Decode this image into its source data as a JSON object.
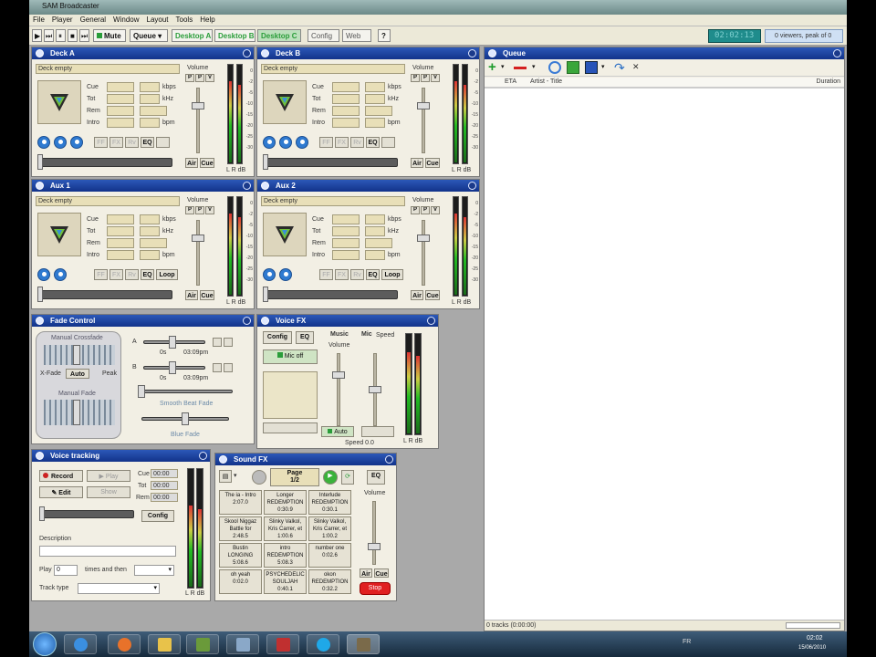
{
  "app": {
    "title": "SAM Broadcaster"
  },
  "menu": [
    "File",
    "Player",
    "General",
    "Window",
    "Layout",
    "Tools",
    "Help"
  ],
  "toolbar": {
    "mute": "Mute",
    "queue": "Queue",
    "desktops": [
      "Desktop A",
      "Desktop B",
      "Desktop C"
    ],
    "config": "Config",
    "web": "Web",
    "help": "?",
    "clock": "02:02:13",
    "listeners": "0 viewers, peak of 0"
  },
  "decks": [
    {
      "title": "Deck A",
      "status": "Deck empty",
      "loop": ""
    },
    {
      "title": "Deck B",
      "status": "Deck empty",
      "loop": ""
    },
    {
      "title": "Aux 1",
      "status": "Deck empty",
      "loop": "Loop"
    },
    {
      "title": "Aux 2",
      "status": "Deck empty",
      "loop": "Loop"
    }
  ],
  "deck_labels": {
    "cue": "Cue",
    "tot": "Tot",
    "rem": "Rem",
    "intro": "Intro",
    "kbps": "kbps",
    "khz": "kHz",
    "bpm": "bpm",
    "volume": "Volume",
    "eq": "EQ",
    "air": "Air",
    "cue_btn": "Cue",
    "lr_db": "L R dB",
    "pfl": [
      "P",
      "P",
      "V"
    ],
    "scale": [
      "0",
      "-2",
      "-5",
      "-10",
      "-15",
      "-20",
      "-25",
      "-30"
    ]
  },
  "fade": {
    "title": "Fade Control",
    "manual_crossfade": "Manual Crossfade",
    "xfade": "X-Fade",
    "auto": "Auto",
    "peak": "Peak",
    "manual_fade": "Manual Fade",
    "a": "A",
    "b": "B",
    "a_val": "0s",
    "a_time": "03:09pm",
    "b_val": "0s",
    "b_time": "03:09pm",
    "smooth": "Smooth Beat Fade",
    "blue_fade": "Blue Fade"
  },
  "voicefx": {
    "title": "Voice FX",
    "config": "Config",
    "eq": "EQ",
    "mic_off": "Mic off",
    "music": "Music",
    "volume": "Volume",
    "mic": "Mic",
    "speed": "Speed",
    "auto": "Auto",
    "speed_val": "Speed 0.0",
    "lr_db": "L R dB"
  },
  "voicetracking": {
    "title": "Voice tracking",
    "record": "Record",
    "play": "Play",
    "edit": "Edit",
    "show": "Show",
    "cue": "Cue",
    "tot": "Tot",
    "rem": "Rem",
    "time_val": "00:00",
    "config": "Config",
    "description": "Description",
    "play_label": "Play",
    "play_value": "0",
    "times_then": "times and then",
    "track_type": "Track type",
    "lr_db": "L R dB"
  },
  "soundfx": {
    "title": "Sound FX",
    "page": "Page",
    "page_num": "1/2",
    "eq": "EQ",
    "volume": "Volume",
    "air": "Air",
    "cue": "Cue",
    "stop": "Stop",
    "lr_db": "L R dB",
    "cells": [
      {
        "name": "The ia - Intro",
        "time": "2:07.0"
      },
      {
        "name": "Longer REDEMPTION",
        "time": "0:30.9"
      },
      {
        "name": "Interlude REDEMPTION",
        "time": "0:30.1"
      },
      {
        "name": "Skool Niggaz Battle for",
        "time": "2:48.5"
      },
      {
        "name": "Slinky Valkol, Kris Carrer, et",
        "time": "1:00.6"
      },
      {
        "name": "Slinky Valkol, Kris Carrer, et",
        "time": "1:00.2"
      },
      {
        "name": "Bustin LONGING",
        "time": "5:08.6"
      },
      {
        "name": "intro REDEMPTION",
        "time": "5:08.3"
      },
      {
        "name": "number one",
        "time": "0:02.6"
      },
      {
        "name": "oh yeah",
        "time": "0:02.0"
      },
      {
        "name": "PSYCHEDELIC SOULJAH",
        "time": "0:40.1"
      },
      {
        "name": "okon REDEMPTION",
        "time": "0:32.2"
      }
    ]
  },
  "queue": {
    "title": "Queue",
    "columns": [
      "ETA",
      "Artist - Title",
      "Duration"
    ],
    "status": "0 tracks (0:00:00)"
  },
  "taskbar": {
    "time": "02:02",
    "date": "15/06/2010",
    "lang": "FR"
  },
  "colors": {
    "title_blue": "#12338a",
    "panel_bg": "#f2efe4",
    "lcd": "#e8dfb8",
    "clock": "#1f8c8c"
  }
}
